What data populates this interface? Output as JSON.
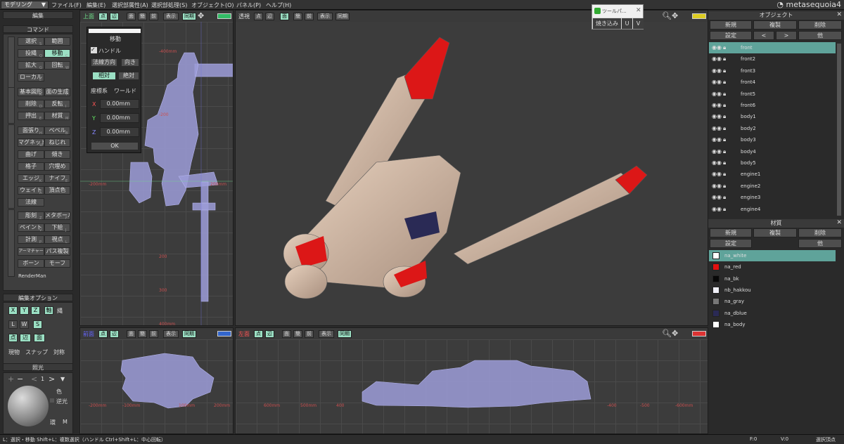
{
  "menubar": {
    "mode": "モデリング",
    "items": [
      "ファイル(F)",
      "編集(E)",
      "選択部属性(A)",
      "選択部処理(S)",
      "オブジェクト(O)",
      "パネル(P)",
      "ヘルプ(H)"
    ],
    "logo": "metasequoia4"
  },
  "left": {
    "edit_label": "編集",
    "command_label": "コマンド",
    "commands": [
      "選択",
      "範囲",
      "投縄",
      "移動",
      "拡大",
      "回転",
      "ローカル",
      "基本図形",
      "面の生成",
      "削除",
      "反転",
      "押出",
      "材質",
      "面張り",
      "ベベル",
      "マグネット",
      "ねじれ",
      "曲げ",
      "傾き",
      "格子",
      "穴埋め",
      "エッジ",
      "ナイフ",
      "ウェイト",
      "頂点色",
      "法線",
      "彫刻",
      "メタボール",
      "ペイント",
      "下絵",
      "計測",
      "視点",
      "アーマチャー",
      "パス複製",
      "ボーン",
      "モーフ",
      "RenderMan"
    ],
    "hotkeys": [
      "S",
      "Q",
      "C",
      "G",
      "W",
      "E",
      "R",
      "T",
      "D",
      "I",
      "E",
      "M",
      "H",
      "B",
      "W",
      "K",
      "E",
      "A",
      "Z",
      "F",
      "V",
      "J",
      "P",
      "L"
    ],
    "edit_options_label": "編集オプション",
    "axis_buttons": [
      "X",
      "Y",
      "Z",
      "軸"
    ],
    "axis_mode": "縄",
    "lws_buttons": [
      "L",
      "W",
      "S"
    ],
    "elem_buttons": [
      "点",
      "辺",
      "面"
    ],
    "option_texts": [
      "現物",
      "スナップ",
      "対称"
    ],
    "light_label": "照光",
    "light_count": "1",
    "light_color": "色",
    "light_reverse": "逆光",
    "light_foot": [
      "環",
      "M"
    ]
  },
  "viewports": {
    "top": {
      "name": "上面"
    },
    "persp": {
      "name": "透視"
    },
    "front": {
      "name": "前面"
    },
    "left": {
      "name": "左面"
    },
    "buttons": [
      "点",
      "辺",
      "面",
      "簡",
      "前",
      "表示",
      "同期"
    ],
    "top_ticks": [
      "-400mm",
      "-200mm",
      "200mm",
      "-200",
      "200",
      "300",
      "400mm"
    ],
    "front_ticks": [
      "-200mm",
      "-100mm",
      "100mm",
      "200mm"
    ],
    "left_ticks": [
      "600mm",
      "500mm",
      "400",
      "-400",
      "-500",
      "-600mm"
    ]
  },
  "move_dialog": {
    "title": "移動",
    "handle_label": "ハンドル",
    "handle_checked": true,
    "normal_btn": "法線方向",
    "dir_btn": "向き",
    "relative": "相対",
    "absolute": "絶対",
    "coord_label": "座標系",
    "coord_value": "ワールド",
    "axes": [
      {
        "label": "X",
        "value": "0.00mm"
      },
      {
        "label": "Y",
        "value": "0.00mm"
      },
      {
        "label": "Z",
        "value": "0.00mm"
      }
    ],
    "ok": "OK"
  },
  "toolpal": {
    "title": "ツールパ...",
    "bake": "焼き込み",
    "u": "U",
    "v": "V"
  },
  "objects": {
    "title": "オブジェクト",
    "buttons": [
      "新規",
      "複製",
      "削除"
    ],
    "buttons2": [
      "設定",
      "<",
      ">",
      "他"
    ],
    "list": [
      "front",
      "front2",
      "front3",
      "front4",
      "front5",
      "front6",
      "body1",
      "body2",
      "body3",
      "body4",
      "body5",
      "engine1",
      "engine2",
      "engine3",
      "engine4"
    ],
    "selected": 0
  },
  "materials": {
    "title": "材質",
    "buttons": [
      "新規",
      "複製",
      "削除"
    ],
    "buttons2": [
      "設定",
      "他"
    ],
    "list": [
      {
        "name": "na_white",
        "color": "#ffffff"
      },
      {
        "name": "na_red",
        "color": "#e01010"
      },
      {
        "name": "na_bk",
        "color": "#080808"
      },
      {
        "name": "nb_hakkou",
        "color": "#f0f0f8"
      },
      {
        "name": "na_gray",
        "color": "#777777"
      },
      {
        "name": "na_dblue",
        "color": "#2a2a55"
      },
      {
        "name": "na_body",
        "color": "#ffffff"
      }
    ],
    "selected": 0
  },
  "status": {
    "hint": "L：選択・移動  Shift+L：複数選択（ハンドル  Ctrl+Shift+L：中心回転）",
    "f": "F:0",
    "v": "V:0",
    "sel": "選択頂点"
  },
  "colors": {
    "accent": "#9be0c4",
    "select": "#5fa39a",
    "wire": "#9c9cd8"
  }
}
